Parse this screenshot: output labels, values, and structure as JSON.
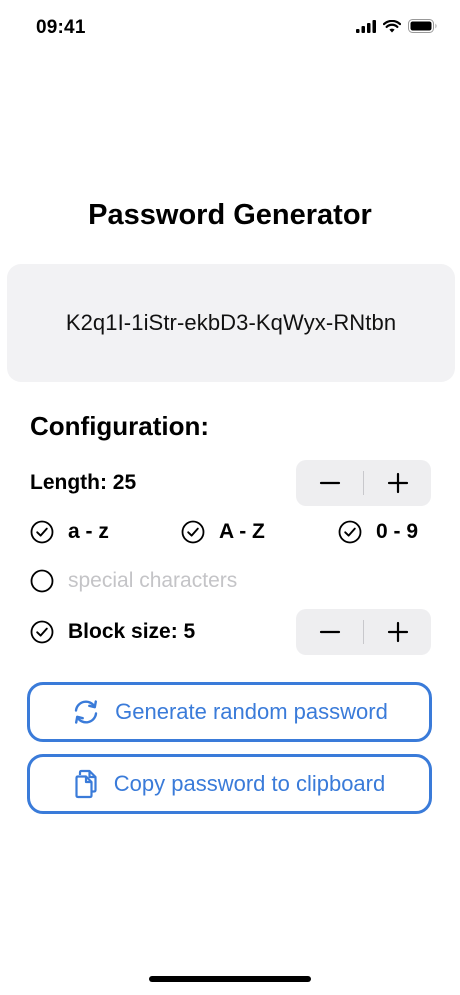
{
  "status_bar": {
    "time": "09:41",
    "icons": [
      "cellular-signal-icon",
      "wifi-icon",
      "battery-icon"
    ]
  },
  "header": {
    "title": "Password Generator"
  },
  "password": {
    "value": "K2q1I-1iStr-ekbD3-KqWyx-RNtbn"
  },
  "configuration": {
    "heading": "Configuration:",
    "length": {
      "label": "Length: 25",
      "decrement_icon": "minus-icon",
      "increment_icon": "plus-icon"
    },
    "options": [
      {
        "label": "a - z",
        "checked": true
      },
      {
        "label": "A - Z",
        "checked": true
      },
      {
        "label": "0 - 9",
        "checked": true
      }
    ],
    "special": {
      "label": "special characters",
      "checked": false
    },
    "block_size": {
      "label": "Block size: 5",
      "checked": true,
      "decrement_icon": "minus-icon",
      "increment_icon": "plus-icon"
    }
  },
  "actions": {
    "generate": {
      "label": "Generate random password",
      "icon": "refresh-icon"
    },
    "copy": {
      "label": "Copy password to clipboard",
      "icon": "copy-icon"
    }
  },
  "colors": {
    "accent": "#3a7bd9",
    "panel": "#f2f2f4",
    "disabled_text": "#c4c4c7"
  }
}
